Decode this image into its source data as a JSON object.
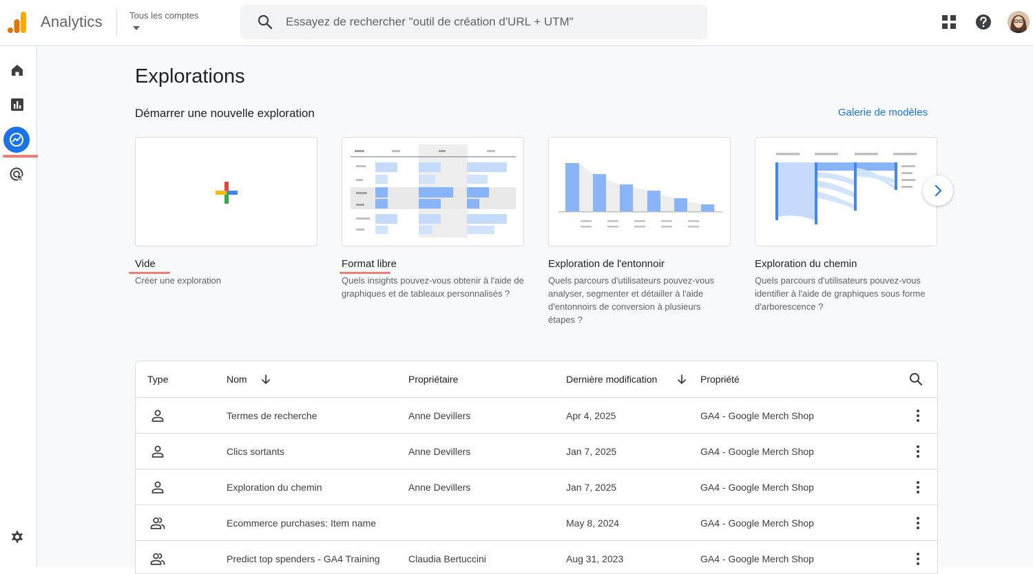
{
  "header": {
    "app_title": "Analytics",
    "account_label": "Tous les comptes",
    "search_placeholder": "Essayez de rechercher \"outil de création d'URL + UTM\""
  },
  "sidebar": {
    "items": [
      {
        "name": "home-icon"
      },
      {
        "name": "reports-icon"
      },
      {
        "name": "explore-icon",
        "active": true
      },
      {
        "name": "advertising-icon"
      }
    ],
    "settings": "gear-icon"
  },
  "page": {
    "title": "Explorations",
    "subtitle": "Démarrer une nouvelle exploration",
    "gallery_link": "Galerie de modèles"
  },
  "templates": [
    {
      "title": "Vide",
      "desc": "Créer une exploration"
    },
    {
      "title": "Format libre",
      "desc": "Quels insights pouvez-vous obtenir à l'aide de graphiques et de tableaux personnalisés ?"
    },
    {
      "title": "Exploration de l'entonnoir",
      "desc": "Quels parcours d'utilisateurs pouvez-vous analyser, segmenter et détailler à l'aide d'entonnoirs de conversion à plusieurs étapes ?"
    },
    {
      "title": "Exploration du chemin",
      "desc": "Quels parcours d'utilisateurs pouvez-vous identifier à l'aide de graphiques sous forme d'arborescence ?"
    }
  ],
  "table": {
    "headers": {
      "type": "Type",
      "name": "Nom",
      "owner": "Propriétaire",
      "modified": "Dernière modification",
      "property": "Propriété"
    },
    "rows": [
      {
        "type": "person",
        "name": "Termes de recherche",
        "owner": "Anne Devillers",
        "modified": "Apr 4, 2025",
        "property": "GA4 - Google Merch Shop"
      },
      {
        "type": "person",
        "name": "Clics sortants",
        "owner": "Anne Devillers",
        "modified": "Jan 7, 2025",
        "property": "GA4 - Google Merch Shop"
      },
      {
        "type": "person",
        "name": "Exploration du chemin",
        "owner": "Anne Devillers",
        "modified": "Jan 7, 2025",
        "property": "GA4 - Google Merch Shop"
      },
      {
        "type": "shared",
        "name": "Ecommerce purchases: Item name",
        "owner": "",
        "modified": "May 8, 2024",
        "property": "GA4 - Google Merch Shop"
      },
      {
        "type": "shared",
        "name": "Predict top spenders - GA4 Training",
        "owner": "Claudia Bertuccini",
        "modified": "Aug 31, 2023",
        "property": "GA4 - Google Merch Shop"
      }
    ]
  },
  "colors": {
    "brand_orange": "#f9ab00",
    "brand_dark_orange": "#e37400",
    "accent_blue": "#1a73e8",
    "highlight_red": "#ee675c",
    "viz_blue": "#8ab4f8"
  }
}
